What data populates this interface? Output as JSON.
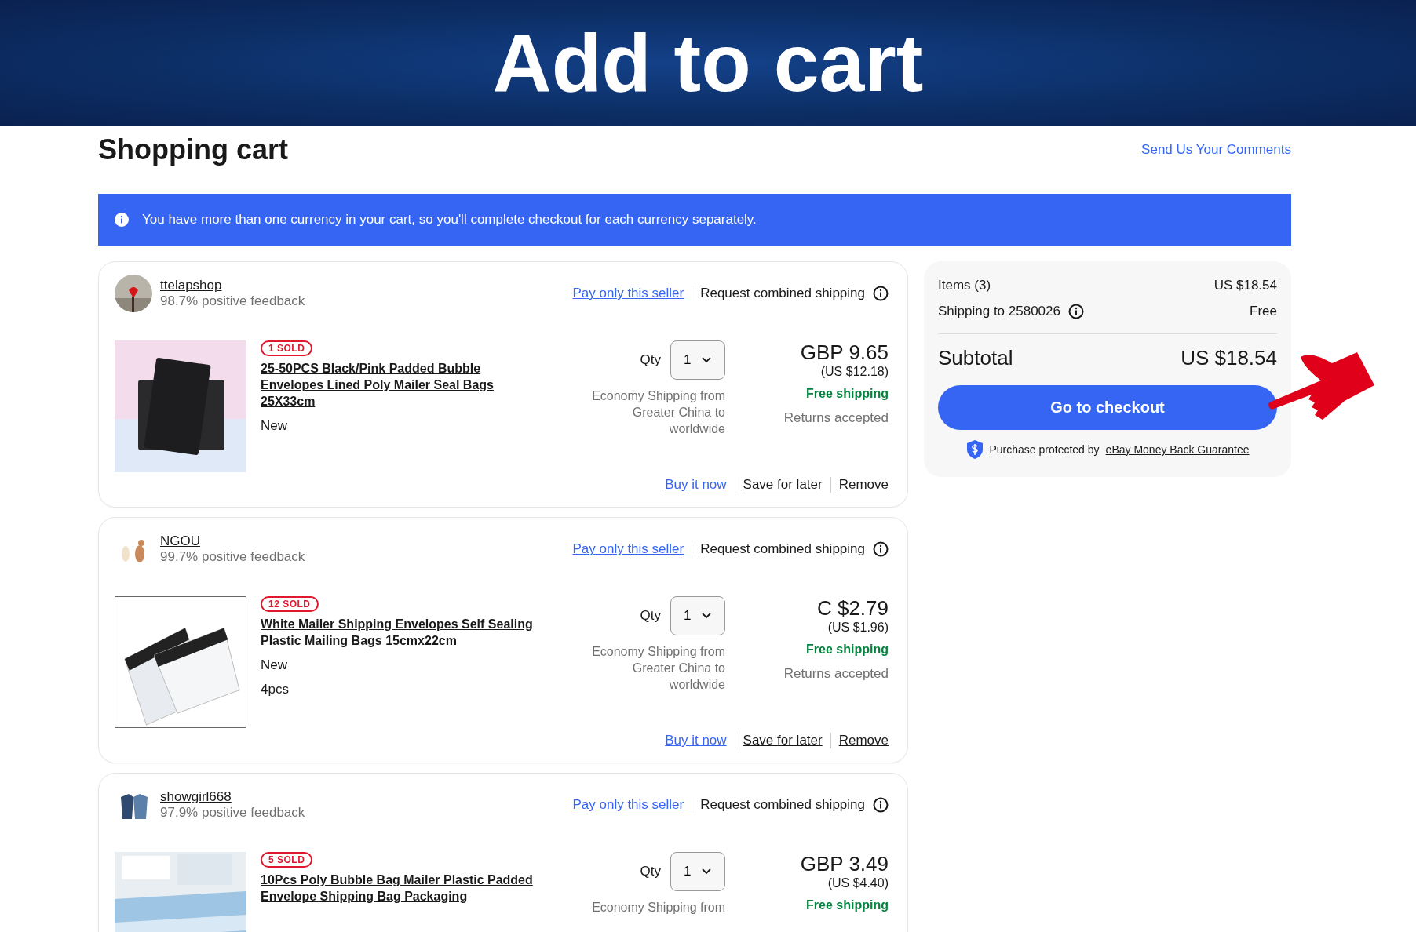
{
  "banner": {
    "title": "Add to cart"
  },
  "header": {
    "title": "Shopping cart",
    "feedback_link": "Send Us Your Comments"
  },
  "notice": {
    "text": "You have more than one currency in your cart, so you'll complete checkout for each currency separately."
  },
  "sellers": [
    {
      "name": "ttelapshop",
      "feedback": "98.7% positive feedback",
      "pay_only": "Pay only this seller",
      "combined": "Request combined shipping",
      "item": {
        "kind": "dark",
        "sold": "1 SOLD",
        "title": "25-50PCS Black/Pink Padded Bubble Envelopes Lined Poly Mailer Seal Bags 25X33cm",
        "details": [
          "New"
        ],
        "qty_label": "Qty",
        "qty": "1",
        "shipping": "Economy Shipping from Greater China to worldwide",
        "price": "GBP 9.65",
        "price_usd": "(US $12.18)",
        "free_shipping": "Free shipping",
        "returns": "Returns accepted"
      },
      "actions": [
        "Buy it now",
        "Save for later",
        "Remove"
      ]
    },
    {
      "name": "NGOU",
      "feedback": "99.7% positive feedback",
      "pay_only": "Pay only this seller",
      "combined": "Request combined shipping",
      "item": {
        "kind": "white",
        "sold": "12 SOLD",
        "title": "White Mailer Shipping Envelopes Self Sealing Plastic Mailing Bags 15cmx22cm",
        "details": [
          "New",
          "4pcs"
        ],
        "qty_label": "Qty",
        "qty": "1",
        "shipping": "Economy Shipping from Greater China to worldwide",
        "price": "C $2.79",
        "price_usd": "(US $1.96)",
        "free_shipping": "Free shipping",
        "returns": "Returns accepted"
      },
      "actions": [
        "Buy it now",
        "Save for later",
        "Remove"
      ]
    },
    {
      "name": "showgirl668",
      "feedback": "97.9% positive feedback",
      "pay_only": "Pay only this seller",
      "combined": "Request combined shipping",
      "item": {
        "kind": "blue",
        "sold": "5 SOLD",
        "title": "10Pcs Poly Bubble Bag Mailer Plastic Padded Envelope Shipping Bag Packaging",
        "qty_label": "Qty",
        "qty": "1",
        "shipping": "Economy Shipping from",
        "price": "GBP 3.49",
        "price_usd": "(US $4.40)",
        "free_shipping": "Free shipping"
      }
    }
  ],
  "summary": {
    "items_label": "Items (3)",
    "items_value": "US $18.54",
    "shipping_label": "Shipping to 2580026",
    "shipping_value": "Free",
    "subtotal_label": "Subtotal",
    "subtotal_value": "US $18.54",
    "checkout": "Go to checkout",
    "protection": "Purchase protected by",
    "guarantee_link": "eBay Money Back Guarantee"
  }
}
